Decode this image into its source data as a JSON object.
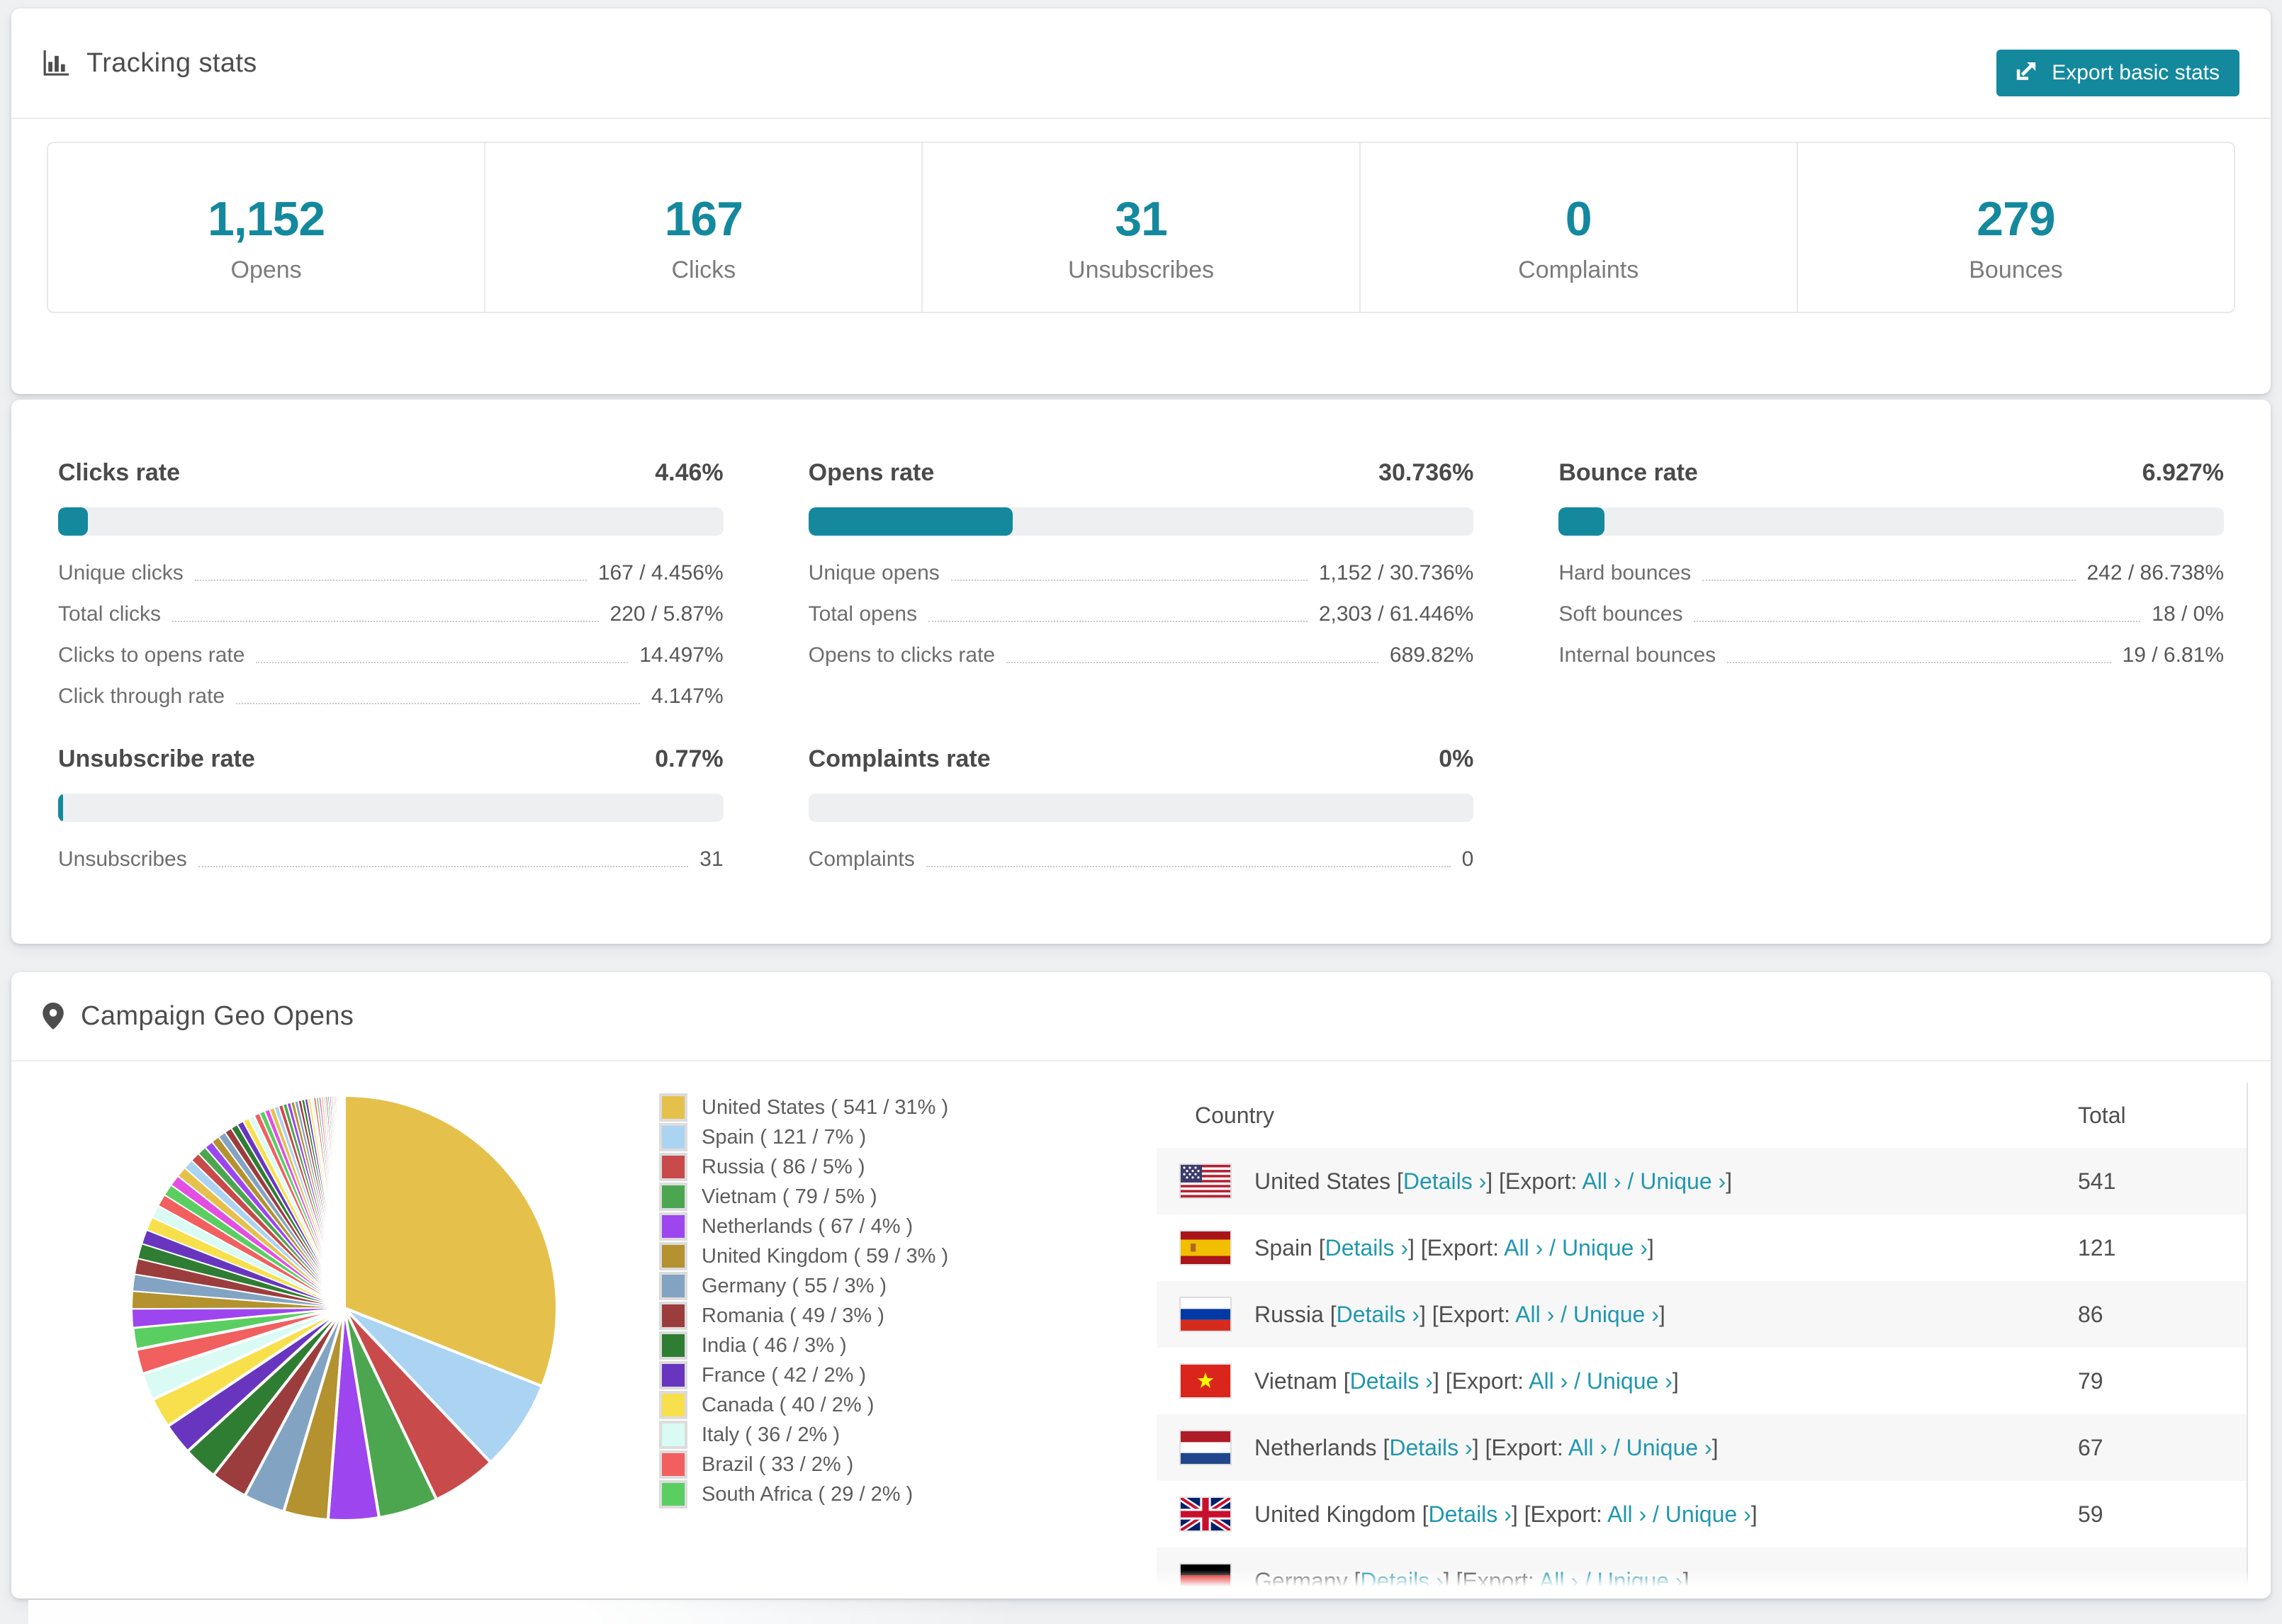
{
  "colors": {
    "accent": "#14899E",
    "link": "#2097AE",
    "bar_track": "#EDEFF1",
    "page_bg": "#EEF0F2"
  },
  "tracking": {
    "title": "Tracking stats",
    "export_label": "Export basic stats",
    "stats": [
      {
        "value": "1,152",
        "label": "Opens"
      },
      {
        "value": "167",
        "label": "Clicks"
      },
      {
        "value": "31",
        "label": "Unsubscribes"
      },
      {
        "value": "0",
        "label": "Complaints"
      },
      {
        "value": "279",
        "label": "Bounces"
      }
    ]
  },
  "rates": [
    {
      "title": "Clicks rate",
      "value": "4.46%",
      "percent": 4.46,
      "rows": [
        {
          "label": "Unique clicks",
          "value": "167 / 4.456%"
        },
        {
          "label": "Total clicks",
          "value": "220 / 5.87%"
        },
        {
          "label": "Clicks to opens rate",
          "value": "14.497%"
        },
        {
          "label": "Click through rate",
          "value": "4.147%"
        }
      ]
    },
    {
      "title": "Opens rate",
      "value": "30.736%",
      "percent": 30.736,
      "rows": [
        {
          "label": "Unique opens",
          "value": "1,152 / 30.736%"
        },
        {
          "label": "Total opens",
          "value": "2,303 / 61.446%"
        },
        {
          "label": "Opens to clicks rate",
          "value": "689.82%"
        }
      ]
    },
    {
      "title": "Bounce rate",
      "value": "6.927%",
      "percent": 6.927,
      "rows": [
        {
          "label": "Hard bounces",
          "value": "242 / 86.738%"
        },
        {
          "label": "Soft bounces",
          "value": "18 / 0%"
        },
        {
          "label": "Internal bounces",
          "value": "19 / 6.81%"
        }
      ]
    },
    {
      "title": "Unsubscribe rate",
      "value": "0.77%",
      "percent": 0.77,
      "rows": [
        {
          "label": "Unsubscribes",
          "value": "31"
        }
      ]
    },
    {
      "title": "Complaints rate",
      "value": "0%",
      "percent": 0,
      "rows": [
        {
          "label": "Complaints",
          "value": "0"
        }
      ]
    }
  ],
  "geo": {
    "title": "Campaign Geo Opens",
    "chart_data": {
      "type": "pie",
      "title": "Campaign Geo Opens",
      "start_angle_deg": -90,
      "direction": "clockwise",
      "legend_position": "right",
      "slices": [
        {
          "name": "United States",
          "count": 541,
          "pct": 31,
          "color": "#E5C14C"
        },
        {
          "name": "Spain",
          "count": 121,
          "pct": 7,
          "color": "#ABD3F2"
        },
        {
          "name": "Russia",
          "count": 86,
          "pct": 5,
          "color": "#C94A4A"
        },
        {
          "name": "Vietnam",
          "count": 79,
          "pct": 5,
          "color": "#4CA64F"
        },
        {
          "name": "Netherlands",
          "count": 67,
          "pct": 4,
          "color": "#9D45EE"
        },
        {
          "name": "United Kingdom",
          "count": 59,
          "pct": 3,
          "color": "#B3922F"
        },
        {
          "name": "Germany",
          "count": 55,
          "pct": 3,
          "color": "#82A4C2"
        },
        {
          "name": "Romania",
          "count": 49,
          "pct": 3,
          "color": "#9C3D3D"
        },
        {
          "name": "India",
          "count": 46,
          "pct": 3,
          "color": "#2F7D33"
        },
        {
          "name": "France",
          "count": 42,
          "pct": 2,
          "color": "#6836BE"
        },
        {
          "name": "Canada",
          "count": 40,
          "pct": 2,
          "color": "#F8E04D"
        },
        {
          "name": "Italy",
          "count": 36,
          "pct": 2,
          "color": "#D9FBF3"
        },
        {
          "name": "Brazil",
          "count": 33,
          "pct": 2,
          "color": "#F15F5F"
        },
        {
          "name": "South Africa",
          "count": 29,
          "pct": 2,
          "color": "#5BCE62"
        }
      ],
      "unlabeled_remainder": {
        "approx_count": 462,
        "approx_pct": 26,
        "note": "long tail of many small unlabeled country slices"
      }
    },
    "legend_format": "{name} ( {count} / {pct}% )",
    "table": {
      "headers": [
        "Country",
        "Total"
      ],
      "link_labels": {
        "details": "Details",
        "export_prefix": "Export:",
        "all": "All",
        "unique": "Unique",
        "arrow": "›"
      },
      "rows": [
        {
          "country": "United States",
          "flag": "us",
          "total": "541"
        },
        {
          "country": "Spain",
          "flag": "es",
          "total": "121"
        },
        {
          "country": "Russia",
          "flag": "ru",
          "total": "86"
        },
        {
          "country": "Vietnam",
          "flag": "vn",
          "total": "79"
        },
        {
          "country": "Netherlands",
          "flag": "nl",
          "total": "67"
        },
        {
          "country": "United Kingdom",
          "flag": "gb",
          "total": "59"
        }
      ],
      "partial_row": {
        "country": "Germany",
        "flag": "de",
        "total": ""
      }
    }
  }
}
